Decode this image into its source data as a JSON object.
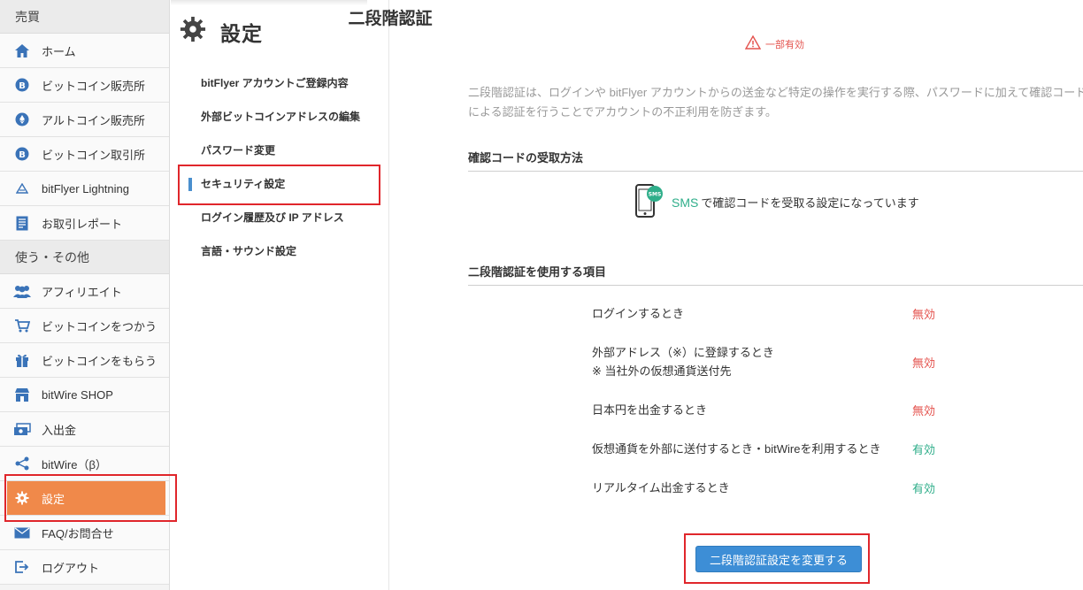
{
  "sidebar": {
    "section_trade": "売買",
    "section_other": "使う・その他",
    "items": [
      {
        "label": "ホーム",
        "icon": "home-icon"
      },
      {
        "label": "ビットコイン販売所",
        "icon": "bitcoin-icon"
      },
      {
        "label": "アルトコイン販売所",
        "icon": "ethereum-icon"
      },
      {
        "label": "ビットコイン取引所",
        "icon": "bitcoin-icon"
      },
      {
        "label": "bitFlyer Lightning",
        "icon": "lightning-icon"
      },
      {
        "label": "お取引レポート",
        "icon": "report-icon"
      },
      {
        "label": "アフィリエイト",
        "icon": "users-icon"
      },
      {
        "label": "ビットコインをつかう",
        "icon": "cart-icon"
      },
      {
        "label": "ビットコインをもらう",
        "icon": "gift-icon"
      },
      {
        "label": "bitWire SHOP",
        "icon": "shop-icon"
      },
      {
        "label": "入出金",
        "icon": "money-icon"
      },
      {
        "label": "bitWire（β）",
        "icon": "share-icon"
      },
      {
        "label": "設定",
        "icon": "gear-icon"
      },
      {
        "label": "FAQ/お問合せ",
        "icon": "mail-icon"
      },
      {
        "label": "ログアウト",
        "icon": "logout-icon"
      }
    ],
    "active_color": "#f0894a"
  },
  "menu": {
    "title": "設定",
    "items": [
      "bitFlyer アカウントご登録内容",
      "外部ビットコインアドレスの編集",
      "パスワード変更",
      "セキュリティ設定",
      "ログイン履歴及び IP アドレス",
      "言語・サウンド設定"
    ],
    "current_index": 3
  },
  "main": {
    "title": "二段階認証",
    "status": "一部有効",
    "description": "二段階認証は、ログインや bitFlyer アカウントからの送金など特定の操作を実行する際、パスワードに加えて確認コードによる認証を行うことでアカウントの不正利用を防ぎます。",
    "receive_heading": "確認コードの受取方法",
    "sms_label": "SMS",
    "sms_text": "で確認コードを受取る設定になっています",
    "usage_heading": "二段階認証を使用する項目",
    "rows": [
      {
        "label": "ログインするとき",
        "note": "",
        "state": "無効",
        "enabled": false
      },
      {
        "label": "外部アドレス（※）に登録するとき",
        "note": "※ 当社外の仮想通貨送付先",
        "state": "無効",
        "enabled": false
      },
      {
        "label": "日本円を出金するとき",
        "note": "",
        "state": "無効",
        "enabled": false
      },
      {
        "label": "仮想通貨を外部に送付するとき・bitWireを利用するとき",
        "note": "",
        "state": "有効",
        "enabled": true
      },
      {
        "label": "リアルタイム出金するとき",
        "note": "",
        "state": "有効",
        "enabled": true
      }
    ],
    "change_button": "二段階認証設定を変更する",
    "colors": {
      "disabled": "#e4534e",
      "enabled": "#2fae8a",
      "button": "#3d8ed6"
    }
  }
}
